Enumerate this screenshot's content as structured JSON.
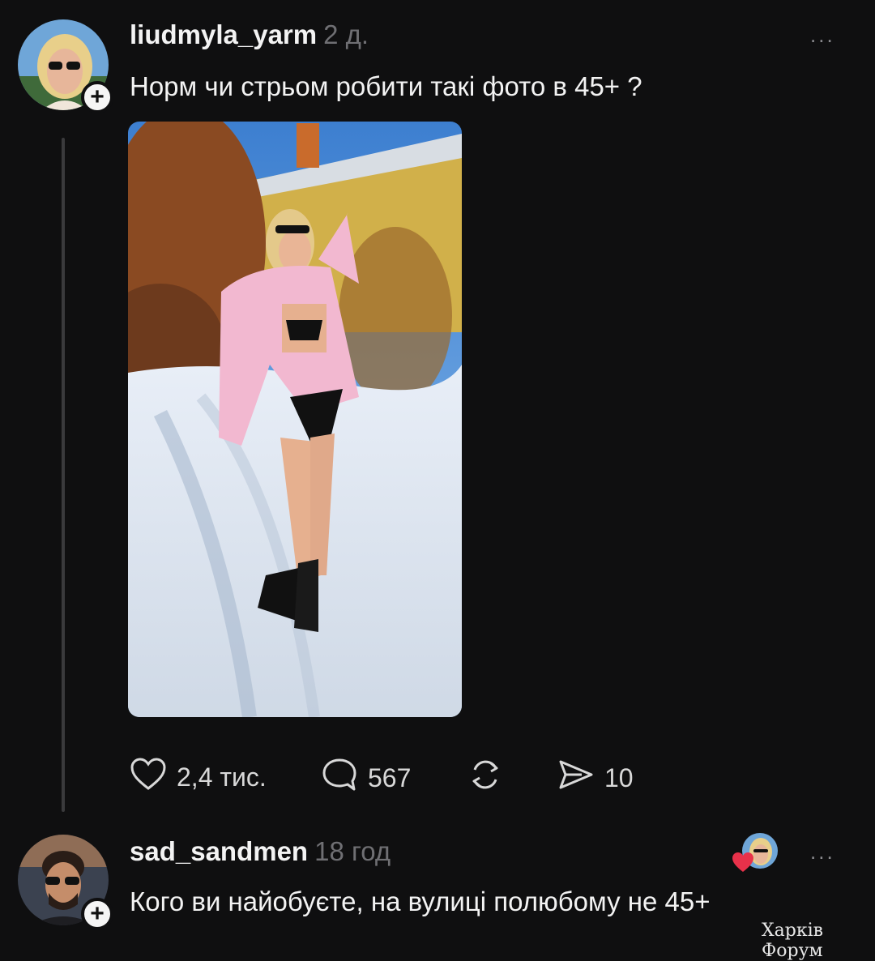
{
  "post": {
    "username": "liudmyla_yarm",
    "time": "2 д.",
    "text": "Норм чи стрьом робити такі фото в  45+ ?",
    "more_label": "...",
    "follow_label": "+",
    "actions": {
      "likes": "2,4 тис.",
      "replies": "567",
      "shares": "10"
    }
  },
  "reply": {
    "username": "sad_sandmen",
    "time": "18 год",
    "text": "Кого ви найобуєте, на вулиці полюбому не 45+",
    "more_label": "...",
    "follow_label": "+"
  },
  "watermark": "Харків Форум",
  "icons": {
    "like": "heart-icon",
    "reply": "comment-icon",
    "repost": "repost-icon",
    "share": "send-icon",
    "liked_by_author": "heart-badge-icon"
  },
  "colors": {
    "background": "#0f0f10",
    "text": "#f3f3f3",
    "muted": "#6f6f73",
    "thread_line": "#3a3a3c",
    "like_red": "#e8314a"
  }
}
